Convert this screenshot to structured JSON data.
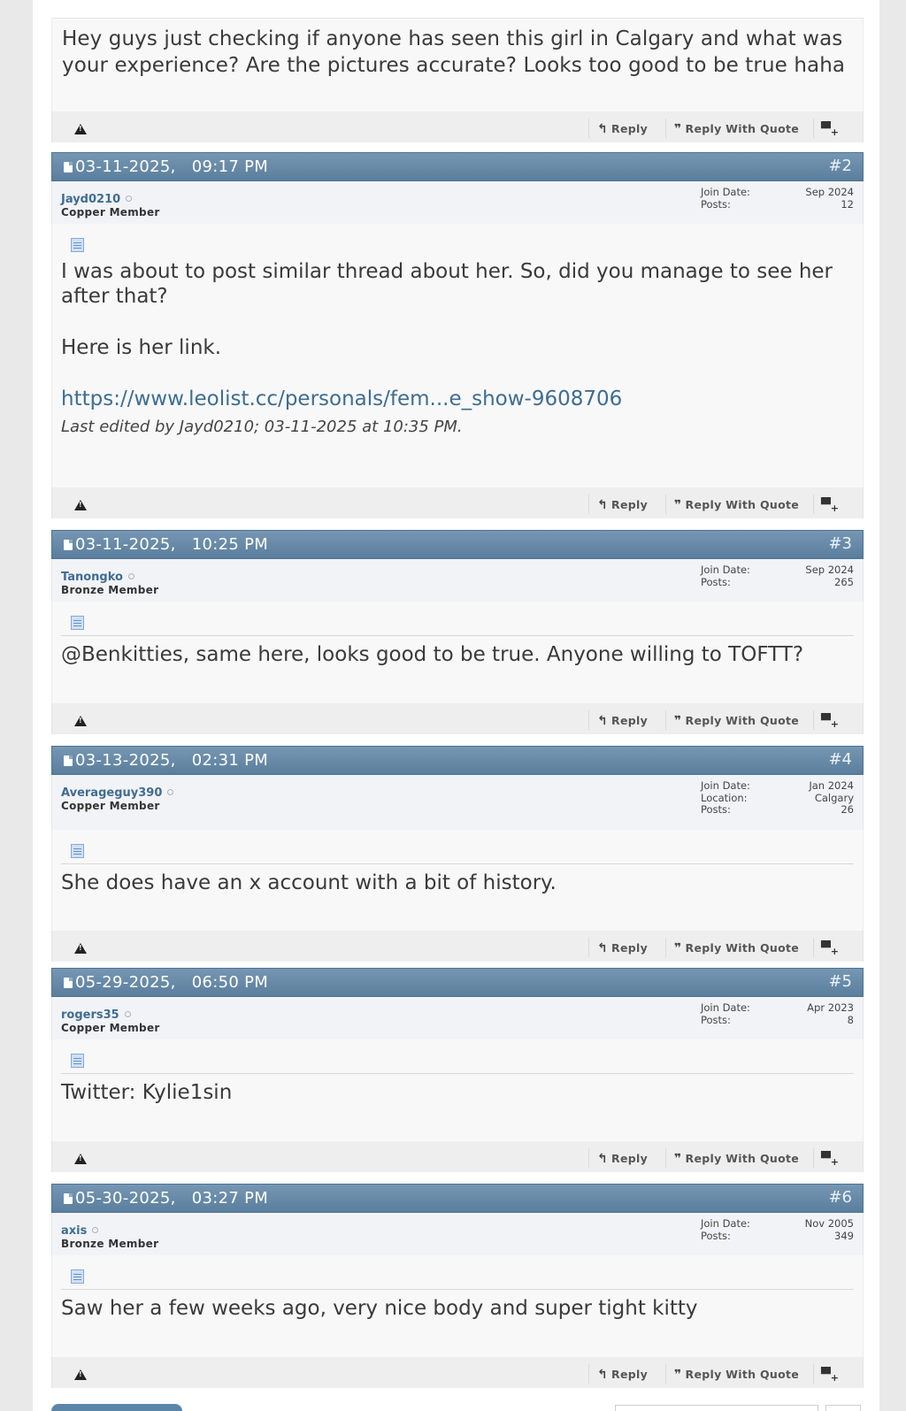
{
  "first_post": {
    "body": "Hey guys just checking if anyone has seen this girl in Calgary and what was your experience? Are the pictures accurate? Looks too good to be true haha"
  },
  "labels": {
    "reply": "Reply",
    "reply_with_quote": "Reply With Quote",
    "join_date": "Join Date:",
    "location": "Location:",
    "posts": "Posts:"
  },
  "posts": [
    {
      "date": "03-11-2025,",
      "time": "09:17 PM",
      "number": "#2",
      "username": "Jayd0210",
      "rank": "Copper Member",
      "join_date": "Sep 2024",
      "post_count": "12",
      "body_lines": [
        "I was about to post similar thread about her. So, did you manage to see her after that?",
        "Here is her link."
      ],
      "link": "https://www.leolist.cc/personals/fem...e_show-9608706",
      "edited": "Last edited by Jayd0210; 03-11-2025 at 10:35 PM."
    },
    {
      "date": "03-11-2025,",
      "time": "10:25 PM",
      "number": "#3",
      "username": "Tanongko",
      "rank": "Bronze Member",
      "join_date": "Sep 2024",
      "post_count": "265",
      "body": "@Benkitties, same here, looks good to be true. Anyone willing to TOFTT?"
    },
    {
      "date": "03-13-2025,",
      "time": "02:31 PM",
      "number": "#4",
      "username": "Averageguy390",
      "rank": "Copper Member",
      "join_date": "Jan 2024",
      "location": "Calgary",
      "post_count": "26",
      "body": "She does have an x account with a bit of history."
    },
    {
      "date": "05-29-2025,",
      "time": "06:50 PM",
      "number": "#5",
      "username": "rogers35",
      "rank": "Copper Member",
      "join_date": "Apr 2023",
      "post_count": "8",
      "body": "Twitter: Kylie1sin"
    },
    {
      "date": "05-30-2025,",
      "time": "03:27 PM",
      "number": "#6",
      "username": "axis",
      "rank": "Bronze Member",
      "join_date": "Nov 2005",
      "post_count": "349",
      "body": "Saw her a few weeks ago, very nice body and super tight kitty"
    }
  ]
}
